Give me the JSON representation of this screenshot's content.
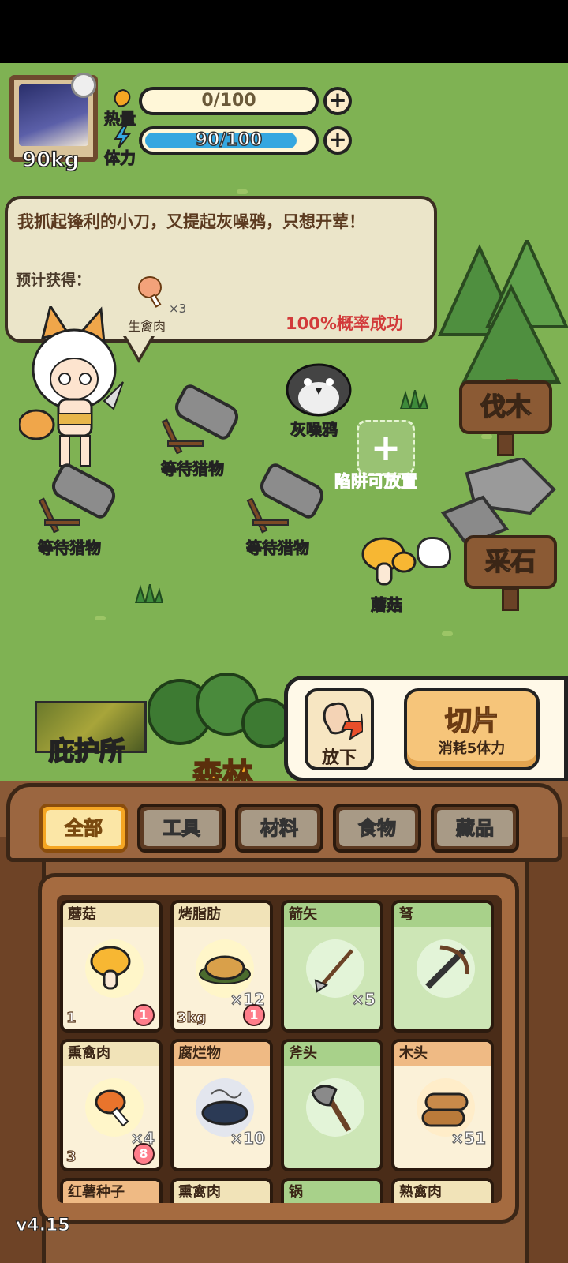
{
  "player": {
    "weight": "90kg",
    "calories": {
      "label": "热量",
      "value": "0/100",
      "fill": 0
    },
    "stamina": {
      "label": "体力",
      "value": "90/100",
      "fill": 0.9
    }
  },
  "dialog": {
    "text": "我抓起锋利的小刀，又提起灰噪鸦，只想开荤！",
    "expected_label": "预计获得：",
    "reward": {
      "name": "生禽肉",
      "count": "×3"
    },
    "success_rate": "100%概率成功"
  },
  "field": {
    "crow_label": "灰噪鸦",
    "trap_labels": [
      "等待猎物",
      "等待猎物",
      "等待猎物"
    ],
    "trap_slot_label": "陷阱可放置",
    "mushroom_label": "蘑菇",
    "sign_logging": "伐木",
    "sign_quarry": "采石"
  },
  "location": {
    "shelter": "庇护所",
    "current": "森林"
  },
  "actions": {
    "drop": "放下",
    "slice": "切片",
    "slice_cost": "消耗5体力"
  },
  "tabs": [
    {
      "label": "全部",
      "active": true
    },
    {
      "label": "工具",
      "active": false
    },
    {
      "label": "材料",
      "active": false
    },
    {
      "label": "食物",
      "active": false
    },
    {
      "label": "藏品",
      "active": false
    }
  ],
  "inventory": [
    {
      "name": "蘑菇",
      "badge_left": "1",
      "badge_right": "1",
      "style": "plain",
      "icon": "mushroom-icon"
    },
    {
      "name": "烤脂肪",
      "qty": "×12",
      "badge_left": "3kg",
      "badge_right": "1",
      "style": "plain",
      "icon": "roasted-fat-icon"
    },
    {
      "name": "箭矢",
      "qty": "×5",
      "style": "green",
      "icon": "arrow-icon"
    },
    {
      "name": "弩",
      "style": "green",
      "icon": "crossbow-icon"
    },
    {
      "name": "熏禽肉",
      "qty": "×4",
      "badge_left": "3",
      "badge_right": "8",
      "style": "plain",
      "icon": "smoked-poultry-icon"
    },
    {
      "name": "腐烂物",
      "qty": "×10",
      "style": "orange",
      "icon": "rotten-icon"
    },
    {
      "name": "斧头",
      "style": "green",
      "icon": "axe-icon"
    },
    {
      "name": "木头",
      "qty": "×51",
      "style": "orange",
      "icon": "wood-icon"
    },
    {
      "name": "红薯种子",
      "style": "orange",
      "icon": "sweet-potato-seed-icon"
    },
    {
      "name": "熏禽肉",
      "style": "plain",
      "icon": "smoked-poultry-icon"
    },
    {
      "name": "锅",
      "style": "green",
      "icon": "pot-icon"
    },
    {
      "name": "熟禽肉",
      "style": "plain",
      "icon": "cooked-poultry-icon"
    }
  ],
  "version": "v4.15",
  "colors": {
    "grass": "#7fb253",
    "accent": "#f5a623",
    "bag": "#8a5a37",
    "stamina": "#35a7e0",
    "alert": "#d23a3a"
  }
}
